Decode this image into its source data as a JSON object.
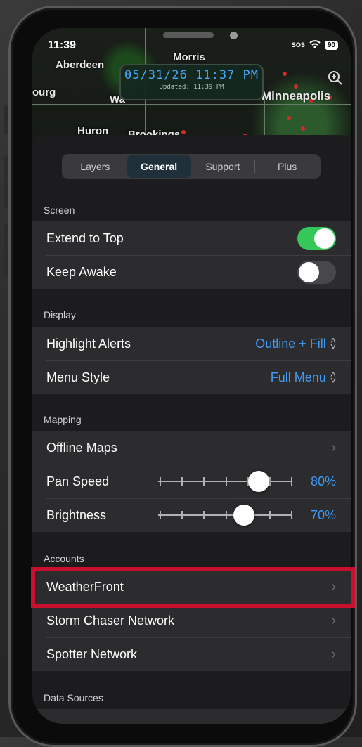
{
  "status_bar": {
    "time": "11:39",
    "sos": "SOS",
    "battery": "90"
  },
  "map": {
    "labels": [
      "Morris",
      "Aberdeen",
      "ourg",
      "Wa",
      "Minneapolis",
      "Huron",
      "Brookings"
    ],
    "timestamp": "05/31/26 11:37 PM",
    "updated": "Updated: 11:39 PM"
  },
  "tabs": [
    "Layers",
    "General",
    "Support",
    "Plus"
  ],
  "active_tab": "General",
  "sections": {
    "screen": {
      "title": "Screen",
      "extend_to_top": {
        "label": "Extend to Top",
        "on": true
      },
      "keep_awake": {
        "label": "Keep Awake",
        "on": false
      }
    },
    "display": {
      "title": "Display",
      "highlight_alerts": {
        "label": "Highlight Alerts",
        "value": "Outline + Fill"
      },
      "menu_style": {
        "label": "Menu Style",
        "value": "Full Menu"
      }
    },
    "mapping": {
      "title": "Mapping",
      "offline_maps": {
        "label": "Offline Maps"
      },
      "pan_speed": {
        "label": "Pan Speed",
        "value": "80%",
        "level": 0.8
      },
      "brightness": {
        "label": "Brightness",
        "value": "70%",
        "level": 0.7
      }
    },
    "accounts": {
      "title": "Accounts",
      "items": [
        "WeatherFront",
        "Storm Chaser Network",
        "Spotter Network"
      ]
    },
    "data_sources": {
      "title": "Data Sources"
    }
  },
  "colors": {
    "toggle_on": "#34c759",
    "accent_blue": "#3f9bf5",
    "highlight": "#c8102e"
  }
}
